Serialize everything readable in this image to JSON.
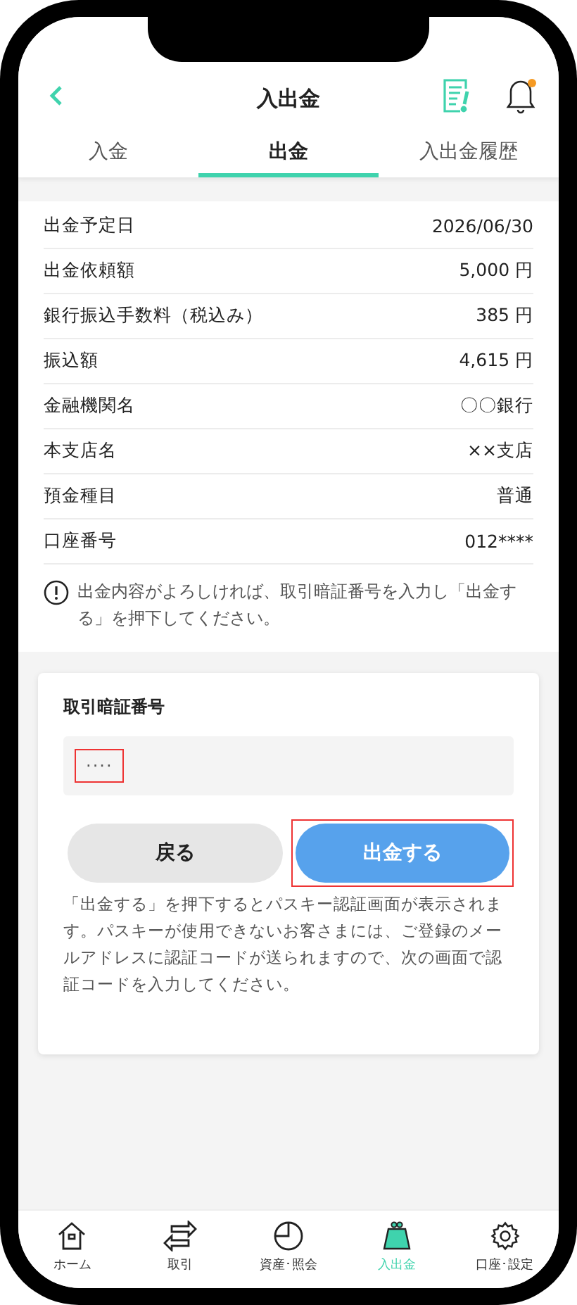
{
  "header": {
    "title": "入出金",
    "notification_dot": true
  },
  "tabs": [
    {
      "label": "入金",
      "selected": false
    },
    {
      "label": "出金",
      "selected": true
    },
    {
      "label": "入出金履歴",
      "selected": false
    }
  ],
  "details": [
    {
      "label": "出金予定日",
      "value": "2026/06/30"
    },
    {
      "label": "出金依頼額",
      "value": "5,000 円"
    },
    {
      "label": "銀行振込手数料（税込み）",
      "value": "385 円"
    },
    {
      "label": "振込額",
      "value": "4,615 円"
    },
    {
      "label": "金融機関名",
      "value": "〇〇銀行"
    },
    {
      "label": "本支店名",
      "value": "××支店"
    },
    {
      "label": "預金種目",
      "value": "普通"
    },
    {
      "label": "口座番号",
      "value": "012****"
    }
  ],
  "notice": "出金内容がよろしければ、取引暗証番号を入力し「出金する」を押下してください。",
  "pin": {
    "label": "取引暗証番号",
    "value": "····",
    "highlighted": true
  },
  "buttons": [
    {
      "label": "戻る",
      "kind": "secondary",
      "highlighted": false
    },
    {
      "label": "出金する",
      "kind": "primary",
      "highlighted": true
    }
  ],
  "note": "「出金する」を押下するとパスキー認証画面が表示されます。パスキーが使用できないお客さまには、ご登録のメールアドレスに認証コードが送られますので、次の画面で認証コードを入力してください。",
  "nav": [
    {
      "label": "ホーム",
      "kind": "home",
      "selected": false
    },
    {
      "label": "取引",
      "kind": "trade",
      "selected": false
    },
    {
      "label": "資産･照会",
      "kind": "chart",
      "selected": false
    },
    {
      "label": "入出金",
      "kind": "purse",
      "selected": true
    },
    {
      "label": "口座･設定",
      "kind": "gear",
      "selected": false
    }
  ]
}
